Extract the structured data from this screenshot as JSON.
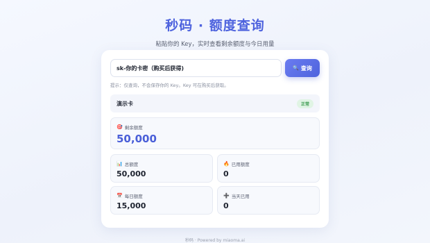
{
  "header": {
    "title": "秒码 · 额度查询",
    "subtitle": "粘贴你的 Key，实时查看剩余额度与今日用量"
  },
  "search": {
    "value": "sk-你的卡密（购买后获得)",
    "button_label": "查询",
    "button_icon": "magnifier-icon",
    "hint": "提示：仅查询，不会保存你的 Key。Key 可在购买后获取。"
  },
  "status": {
    "card_name": "演示卡",
    "badge": "正常",
    "badge_color": "#3a9a4e"
  },
  "remaining": {
    "label": "剩余额度",
    "icon": "target-icon",
    "value": "50,000",
    "value_color": "#4a5fd8"
  },
  "stats": [
    {
      "label": "总额度",
      "icon": "bar-chart-icon",
      "value": "50,000"
    },
    {
      "label": "已用额度",
      "icon": "fire-icon",
      "value": "0"
    },
    {
      "label": "每日额度",
      "icon": "calendar-icon",
      "value": "15,000"
    },
    {
      "label": "当天已用",
      "icon": "plus-icon",
      "value": "0"
    }
  ],
  "footer": {
    "text": "秒码 · Powered by miaoma.ai"
  },
  "accent_color": "#4e63de"
}
